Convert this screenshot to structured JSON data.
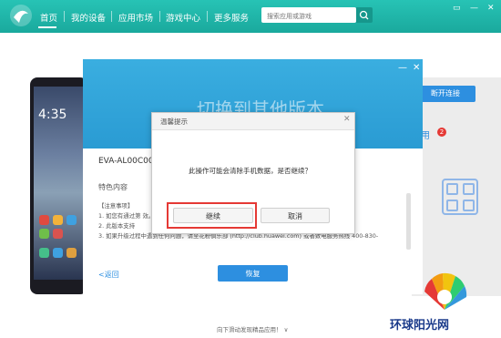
{
  "nav": {
    "home": "首页",
    "my_device": "我的设备",
    "app_market": "应用市场",
    "game_center": "游戏中心",
    "more_services": "更多服务"
  },
  "search": {
    "placeholder": "搜索应用或游戏"
  },
  "phone": {
    "time": "4:35"
  },
  "right_panel": {
    "disconnect_label": "断开连接",
    "app_label": "用",
    "badge_count": "2"
  },
  "switch_dialog": {
    "title": "切换到其他版本",
    "device_model": "EVA-AL00C00B",
    "feature_title": "特色内容",
    "notes": [
      "【注意事项】",
      "1. 如您有通过第                                                      效。",
      "2. 此版本支持",
      "3. 如果升级过程中遇到任何问题，请至花粉俱乐部 (http://club.huawei.com) 或者致电服务热线 400-830-"
    ],
    "back_label": "<返回",
    "restore_label": "恢复"
  },
  "tip_dialog": {
    "title": "温馨提示",
    "message": "此操作可能会清除手机数据，是否继续？",
    "continue_label": "继续",
    "cancel_label": "取消"
  },
  "bottom_hint": "向下滑动发现精品应用！ ∨",
  "watermark": {
    "text": "环球阳光网"
  },
  "colors": {
    "topbar": "#1fb5a8",
    "dialog_blue": "#2d8fe0",
    "highlight_red": "#e53935"
  }
}
